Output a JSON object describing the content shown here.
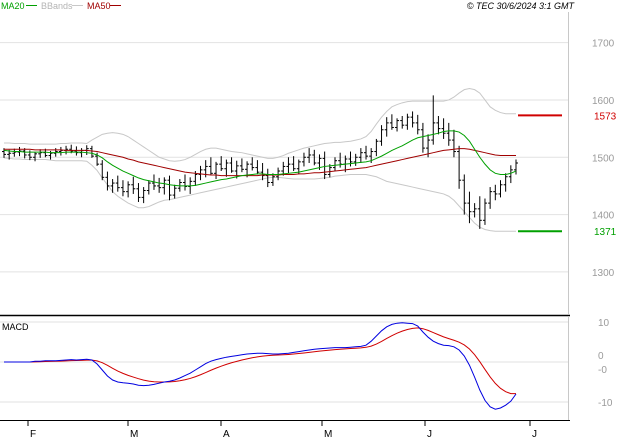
{
  "chart_data": {
    "type": "line",
    "copyright": "© TEC 30/6/2024 3:1 GMT",
    "legend": [
      {
        "label": "MA20",
        "color": "#00a000"
      },
      {
        "label": "BBands",
        "color": "#c8c8c8"
      },
      {
        "label": "MA50",
        "color": "#a00000"
      }
    ],
    "price_axis": {
      "ticks": [
        1700,
        1600,
        1500,
        1400,
        1300
      ],
      "ylim": [
        1230,
        1750
      ]
    },
    "macd_axis": {
      "label": "MACD",
      "ticks": [
        "10",
        "0",
        "-0",
        "-10"
      ],
      "ylim": [
        -14,
        11
      ]
    },
    "months": [
      "F",
      "M",
      "A",
      "M",
      "J",
      "J"
    ],
    "markers": [
      {
        "label": "1573",
        "value": 1573,
        "color": "#d00000"
      },
      {
        "label": "1371",
        "value": 1371,
        "color": "#00a000"
      }
    ],
    "series": {
      "ohlc": [
        [
          1510,
          1516,
          1499,
          1505
        ],
        [
          1505,
          1513,
          1496,
          1507
        ],
        [
          1507,
          1515,
          1501,
          1509
        ],
        [
          1509,
          1518,
          1502,
          1511
        ],
        [
          1511,
          1516,
          1498,
          1504
        ],
        [
          1504,
          1512,
          1495,
          1500
        ],
        [
          1500,
          1509,
          1493,
          1506
        ],
        [
          1506,
          1514,
          1499,
          1508
        ],
        [
          1508,
          1515,
          1500,
          1503
        ],
        [
          1503,
          1511,
          1496,
          1507
        ],
        [
          1507,
          1516,
          1501,
          1510
        ],
        [
          1510,
          1518,
          1503,
          1512
        ],
        [
          1512,
          1520,
          1505,
          1514
        ],
        [
          1514,
          1522,
          1507,
          1511
        ],
        [
          1511,
          1519,
          1503,
          1508
        ],
        [
          1508,
          1516,
          1500,
          1512
        ],
        [
          1512,
          1521,
          1504,
          1515
        ],
        [
          1515,
          1520,
          1499,
          1502
        ],
        [
          1502,
          1508,
          1485,
          1488
        ],
        [
          1488,
          1495,
          1460,
          1465
        ],
        [
          1465,
          1475,
          1442,
          1450
        ],
        [
          1450,
          1462,
          1438,
          1455
        ],
        [
          1455,
          1468,
          1440,
          1447
        ],
        [
          1447,
          1460,
          1432,
          1440
        ],
        [
          1440,
          1458,
          1430,
          1452
        ],
        [
          1452,
          1466,
          1436,
          1445
        ],
        [
          1445,
          1455,
          1422,
          1430
        ],
        [
          1430,
          1448,
          1420,
          1442
        ],
        [
          1442,
          1460,
          1435,
          1455
        ],
        [
          1455,
          1470,
          1443,
          1450
        ],
        [
          1450,
          1464,
          1438,
          1447
        ],
        [
          1447,
          1465,
          1435,
          1460
        ],
        [
          1460,
          1468,
          1425,
          1434
        ],
        [
          1434,
          1452,
          1428,
          1446
        ],
        [
          1446,
          1462,
          1440,
          1456
        ],
        [
          1456,
          1470,
          1442,
          1449
        ],
        [
          1449,
          1465,
          1436,
          1458
        ],
        [
          1458,
          1476,
          1450,
          1470
        ],
        [
          1470,
          1485,
          1460,
          1478
        ],
        [
          1478,
          1495,
          1465,
          1484
        ],
        [
          1484,
          1500,
          1470,
          1472
        ],
        [
          1472,
          1492,
          1462,
          1488
        ],
        [
          1488,
          1502,
          1476,
          1480
        ],
        [
          1480,
          1496,
          1466,
          1490
        ],
        [
          1490,
          1500,
          1473,
          1476
        ],
        [
          1476,
          1494,
          1463,
          1485
        ],
        [
          1485,
          1498,
          1474,
          1479
        ],
        [
          1479,
          1493,
          1465,
          1488
        ],
        [
          1488,
          1500,
          1477,
          1482
        ],
        [
          1482,
          1495,
          1470,
          1474
        ],
        [
          1474,
          1490,
          1460,
          1468
        ],
        [
          1468,
          1480,
          1448,
          1456
        ],
        [
          1456,
          1472,
          1450,
          1466
        ],
        [
          1466,
          1482,
          1460,
          1476
        ],
        [
          1476,
          1492,
          1468,
          1484
        ],
        [
          1484,
          1500,
          1472,
          1488
        ],
        [
          1488,
          1502,
          1476,
          1480
        ],
        [
          1480,
          1496,
          1470,
          1492
        ],
        [
          1492,
          1508,
          1484,
          1500
        ],
        [
          1500,
          1516,
          1490,
          1504
        ],
        [
          1504,
          1513,
          1486,
          1490
        ],
        [
          1490,
          1505,
          1478,
          1498
        ],
        [
          1498,
          1510,
          1462,
          1470
        ],
        [
          1470,
          1488,
          1465,
          1482
        ],
        [
          1482,
          1500,
          1476,
          1494
        ],
        [
          1494,
          1508,
          1482,
          1488
        ],
        [
          1488,
          1503,
          1474,
          1497
        ],
        [
          1497,
          1510,
          1484,
          1492
        ],
        [
          1492,
          1506,
          1485,
          1500
        ],
        [
          1500,
          1516,
          1490,
          1508
        ],
        [
          1508,
          1520,
          1496,
          1502
        ],
        [
          1502,
          1516,
          1490,
          1510
        ],
        [
          1510,
          1532,
          1502,
          1528
        ],
        [
          1528,
          1556,
          1520,
          1548
        ],
        [
          1548,
          1570,
          1536,
          1560
        ],
        [
          1560,
          1575,
          1548,
          1552
        ],
        [
          1552,
          1568,
          1545,
          1564
        ],
        [
          1564,
          1572,
          1550,
          1556
        ],
        [
          1556,
          1576,
          1548,
          1570
        ],
        [
          1570,
          1580,
          1552,
          1560
        ],
        [
          1560,
          1574,
          1540,
          1548
        ],
        [
          1548,
          1560,
          1508,
          1516
        ],
        [
          1516,
          1540,
          1500,
          1530
        ],
        [
          1530,
          1608,
          1522,
          1560
        ],
        [
          1560,
          1572,
          1540,
          1550
        ],
        [
          1550,
          1568,
          1532,
          1542
        ],
        [
          1542,
          1560,
          1520,
          1530
        ],
        [
          1530,
          1548,
          1500,
          1510
        ],
        [
          1510,
          1520,
          1445,
          1460
        ],
        [
          1460,
          1470,
          1400,
          1420
        ],
        [
          1420,
          1440,
          1385,
          1405
        ],
        [
          1405,
          1420,
          1395,
          1410
        ],
        [
          1410,
          1432,
          1375,
          1390
        ],
        [
          1390,
          1428,
          1382,
          1420
        ],
        [
          1420,
          1448,
          1410,
          1440
        ],
        [
          1440,
          1452,
          1425,
          1436
        ],
        [
          1436,
          1460,
          1430,
          1452
        ],
        [
          1452,
          1472,
          1440,
          1466
        ],
        [
          1466,
          1486,
          1455,
          1478
        ],
        [
          1478,
          1496,
          1470,
          1490
        ]
      ],
      "ma20": [
        1512,
        1511,
        1510,
        1510,
        1509,
        1509,
        1509,
        1509,
        1509,
        1508,
        1508,
        1508,
        1509,
        1509,
        1509,
        1509,
        1508,
        1507,
        1504,
        1499,
        1492,
        1486,
        1481,
        1476,
        1472,
        1468,
        1464,
        1461,
        1459,
        1457,
        1455,
        1454,
        1452,
        1451,
        1450,
        1450,
        1450,
        1451,
        1453,
        1455,
        1457,
        1459,
        1461,
        1462,
        1464,
        1466,
        1468,
        1469,
        1470,
        1471,
        1471,
        1470,
        1470,
        1470,
        1471,
        1472,
        1473,
        1474,
        1476,
        1478,
        1480,
        1482,
        1484,
        1485,
        1486,
        1487,
        1488,
        1489,
        1490,
        1491,
        1492,
        1494,
        1498,
        1502,
        1507,
        1512,
        1516,
        1520,
        1525,
        1530,
        1534,
        1536,
        1538,
        1540,
        1542,
        1545,
        1546,
        1546,
        1544,
        1538,
        1528,
        1514,
        1500,
        1488,
        1478,
        1472,
        1470,
        1470,
        1472,
        1476
      ],
      "ma50": [
        1514,
        1514,
        1514,
        1514,
        1514,
        1514,
        1513,
        1513,
        1513,
        1513,
        1513,
        1513,
        1512,
        1512,
        1512,
        1512,
        1512,
        1511,
        1510,
        1508,
        1506,
        1504,
        1502,
        1500,
        1497,
        1495,
        1492,
        1490,
        1488,
        1486,
        1484,
        1482,
        1480,
        1478,
        1476,
        1474,
        1473,
        1472,
        1471,
        1470,
        1469,
        1469,
        1468,
        1468,
        1468,
        1468,
        1468,
        1468,
        1468,
        1468,
        1469,
        1469,
        1469,
        1469,
        1470,
        1470,
        1470,
        1471,
        1471,
        1472,
        1473,
        1473,
        1474,
        1475,
        1476,
        1477,
        1478,
        1479,
        1480,
        1481,
        1482,
        1484,
        1486,
        1488,
        1490,
        1492,
        1494,
        1496,
        1498,
        1500,
        1502,
        1504,
        1506,
        1508,
        1510,
        1512,
        1513,
        1514,
        1515,
        1515,
        1514,
        1512,
        1510,
        1508,
        1506,
        1504,
        1503,
        1503,
        1503,
        1503
      ],
      "bb_upper": [
        1525,
        1525,
        1524,
        1524,
        1524,
        1523,
        1523,
        1523,
        1523,
        1523,
        1523,
        1524,
        1524,
        1525,
        1525,
        1525,
        1524,
        1530,
        1535,
        1540,
        1542,
        1543,
        1542,
        1540,
        1536,
        1530,
        1524,
        1518,
        1512,
        1506,
        1500,
        1497,
        1494,
        1493,
        1494,
        1496,
        1500,
        1505,
        1510,
        1514,
        1516,
        1516,
        1514,
        1512,
        1510,
        1509,
        1508,
        1506,
        1504,
        1502,
        1500,
        1498,
        1498,
        1500,
        1503,
        1507,
        1510,
        1513,
        1516,
        1518,
        1520,
        1522,
        1524,
        1525,
        1526,
        1526,
        1527,
        1528,
        1530,
        1532,
        1536,
        1545,
        1558,
        1570,
        1580,
        1588,
        1592,
        1595,
        1597,
        1598,
        1598,
        1598,
        1598,
        1598,
        1598,
        1598,
        1600,
        1605,
        1612,
        1618,
        1620,
        1618,
        1612,
        1600,
        1588,
        1582,
        1578,
        1576,
        1576,
        1576
      ],
      "bb_lower": [
        1499,
        1498,
        1497,
        1497,
        1496,
        1496,
        1496,
        1496,
        1496,
        1495,
        1494,
        1494,
        1494,
        1494,
        1494,
        1494,
        1493,
        1486,
        1477,
        1464,
        1452,
        1440,
        1432,
        1426,
        1420,
        1416,
        1412,
        1412,
        1414,
        1418,
        1422,
        1425,
        1426,
        1428,
        1430,
        1432,
        1434,
        1436,
        1438,
        1440,
        1442,
        1444,
        1446,
        1448,
        1450,
        1452,
        1454,
        1456,
        1458,
        1460,
        1462,
        1464,
        1465,
        1465,
        1464,
        1463,
        1462,
        1462,
        1462,
        1462,
        1462,
        1463,
        1464,
        1465,
        1467,
        1468,
        1469,
        1470,
        1470,
        1470,
        1470,
        1468,
        1466,
        1462,
        1458,
        1456,
        1454,
        1452,
        1450,
        1448,
        1446,
        1444,
        1442,
        1440,
        1438,
        1436,
        1432,
        1425,
        1415,
        1405,
        1395,
        1385,
        1378,
        1374,
        1372,
        1371,
        1371,
        1371,
        1371,
        1371
      ],
      "macd": [
        0,
        0,
        0,
        0,
        0,
        0,
        0.2,
        0.2,
        0.3,
        0.3,
        0.3,
        0.4,
        0.5,
        0.6,
        0.5,
        0.6,
        0.7,
        0.5,
        -0.5,
        -2,
        -3.5,
        -4.5,
        -5,
        -5.2,
        -5.3,
        -5.5,
        -5.8,
        -5.9,
        -5.8,
        -5.6,
        -5.3,
        -5,
        -4.8,
        -4.5,
        -4,
        -3.4,
        -2.8,
        -2,
        -1.2,
        -0.4,
        0.2,
        0.6,
        0.9,
        1.2,
        1.4,
        1.6,
        1.8,
        2,
        2.1,
        2.2,
        2.2,
        2.1,
        2,
        2,
        2.1,
        2.2,
        2.4,
        2.6,
        2.8,
        3,
        3.2,
        3.3,
        3.4,
        3.5,
        3.6,
        3.6,
        3.6,
        3.7,
        3.8,
        3.9,
        4.2,
        5.2,
        6.5,
        7.8,
        8.8,
        9.4,
        9.7,
        9.8,
        9.7,
        9.6,
        9,
        7.5,
        6.2,
        5.2,
        4.6,
        4.2,
        4.1,
        3.8,
        3,
        1.5,
        -0.8,
        -3.8,
        -7,
        -9.6,
        -11.2,
        -11.8,
        -11.5,
        -10.8,
        -9.8,
        -8
      ]
    }
  }
}
